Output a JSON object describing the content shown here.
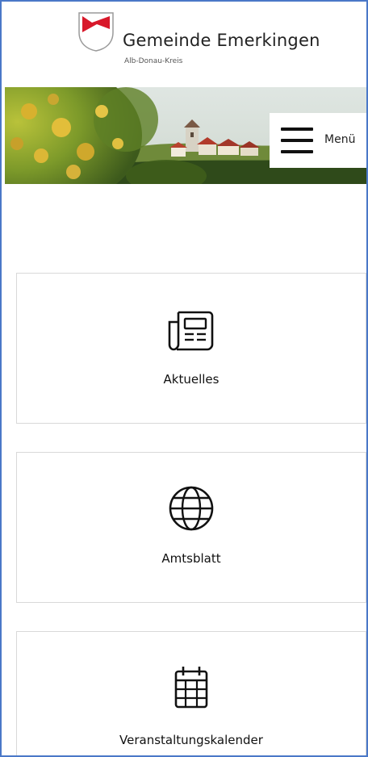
{
  "header": {
    "site_name": "Gemeinde Emerkingen",
    "site_subtitle": "Alb-Donau-Kreis",
    "crest_icon": "municipal-crest-icon"
  },
  "menu": {
    "label": "Menü",
    "icon": "hamburger-menu-icon"
  },
  "tiles": [
    {
      "label": "Aktuelles",
      "icon": "newspaper-icon"
    },
    {
      "label": "Amtsblatt",
      "icon": "globe-icon"
    },
    {
      "label": "Veranstaltungskalender",
      "icon": "calendar-icon"
    }
  ],
  "colors": {
    "frame_border": "#4a78c8",
    "crest_red": "#d8182a",
    "tile_border": "#d9d9d9"
  }
}
